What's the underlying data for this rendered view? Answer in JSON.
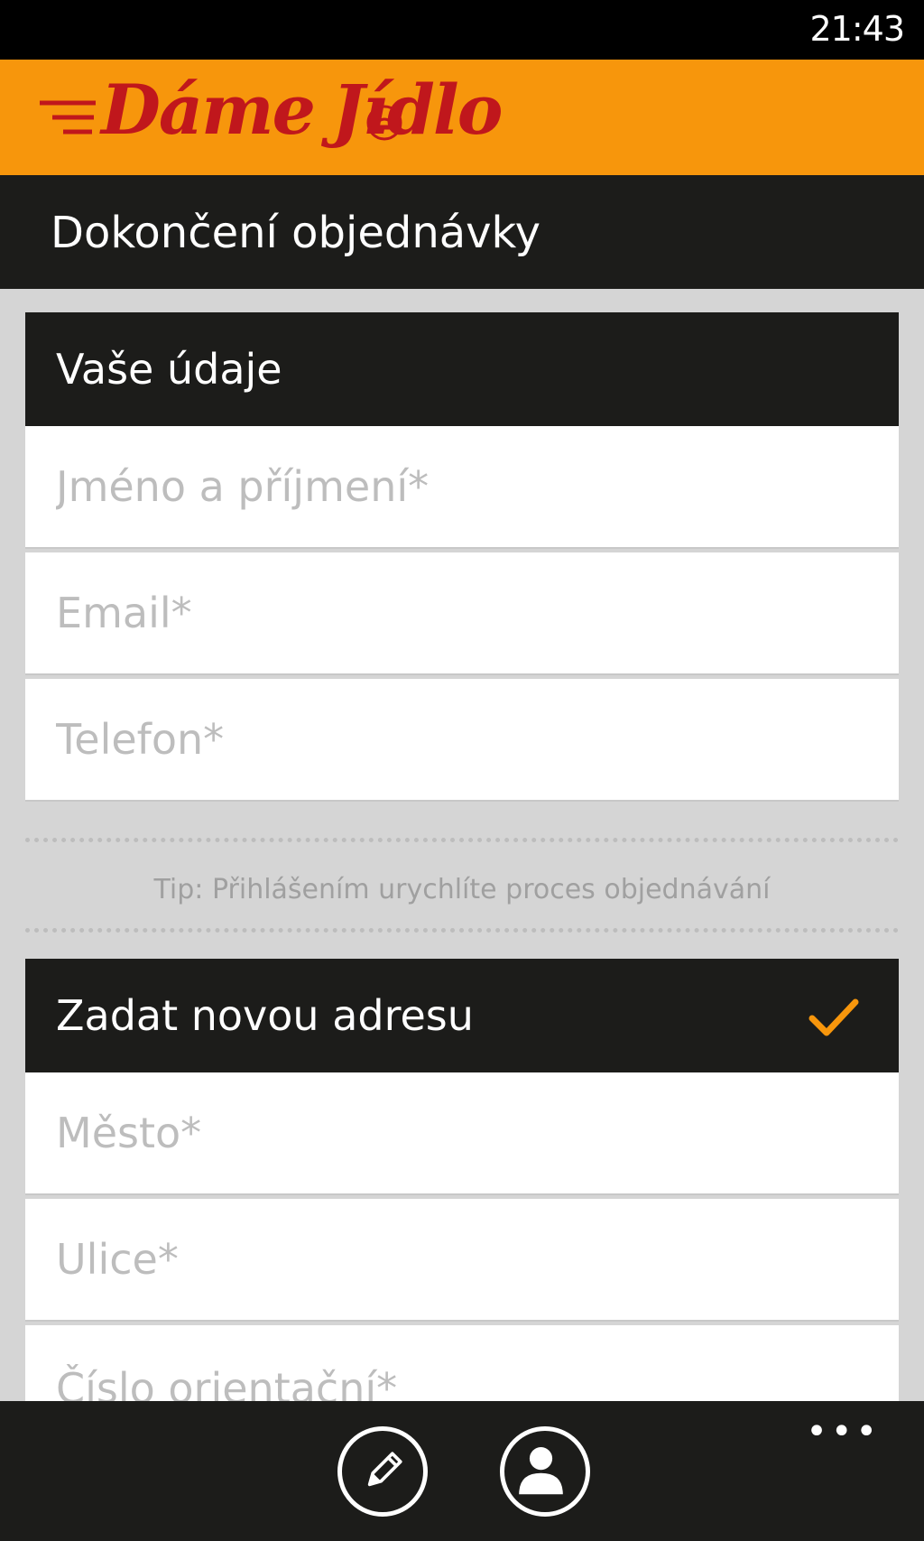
{
  "status_bar": {
    "time": "21:43"
  },
  "brand": {
    "logo_word1": "Dáme",
    "logo_word2": "Jídlo"
  },
  "page": {
    "title": "Dokončení objednávky"
  },
  "personal_section": {
    "header": "Vaše údaje",
    "fields": [
      {
        "placeholder": "Jméno a příjmení*",
        "value": ""
      },
      {
        "placeholder": "Email*",
        "value": ""
      },
      {
        "placeholder": "Telefon*",
        "value": ""
      }
    ]
  },
  "tip": "Tip: Přihlášením urychlíte proces objednávání",
  "address_section": {
    "header": "Zadat novou adresu",
    "checked": true,
    "fields": [
      {
        "placeholder": "Město*",
        "value": ""
      },
      {
        "placeholder": "Ulice*",
        "value": ""
      },
      {
        "placeholder": "Číslo orientační*",
        "value": ""
      }
    ]
  },
  "app_bar": {
    "buttons": [
      {
        "icon": "pencil-icon"
      },
      {
        "icon": "user-icon"
      }
    ],
    "more": "•••"
  },
  "colors": {
    "brand_orange": "#f7960c",
    "logo_red": "#c0171c",
    "dark_bar": "#1c1c1a",
    "accent_check": "#f7960c"
  }
}
